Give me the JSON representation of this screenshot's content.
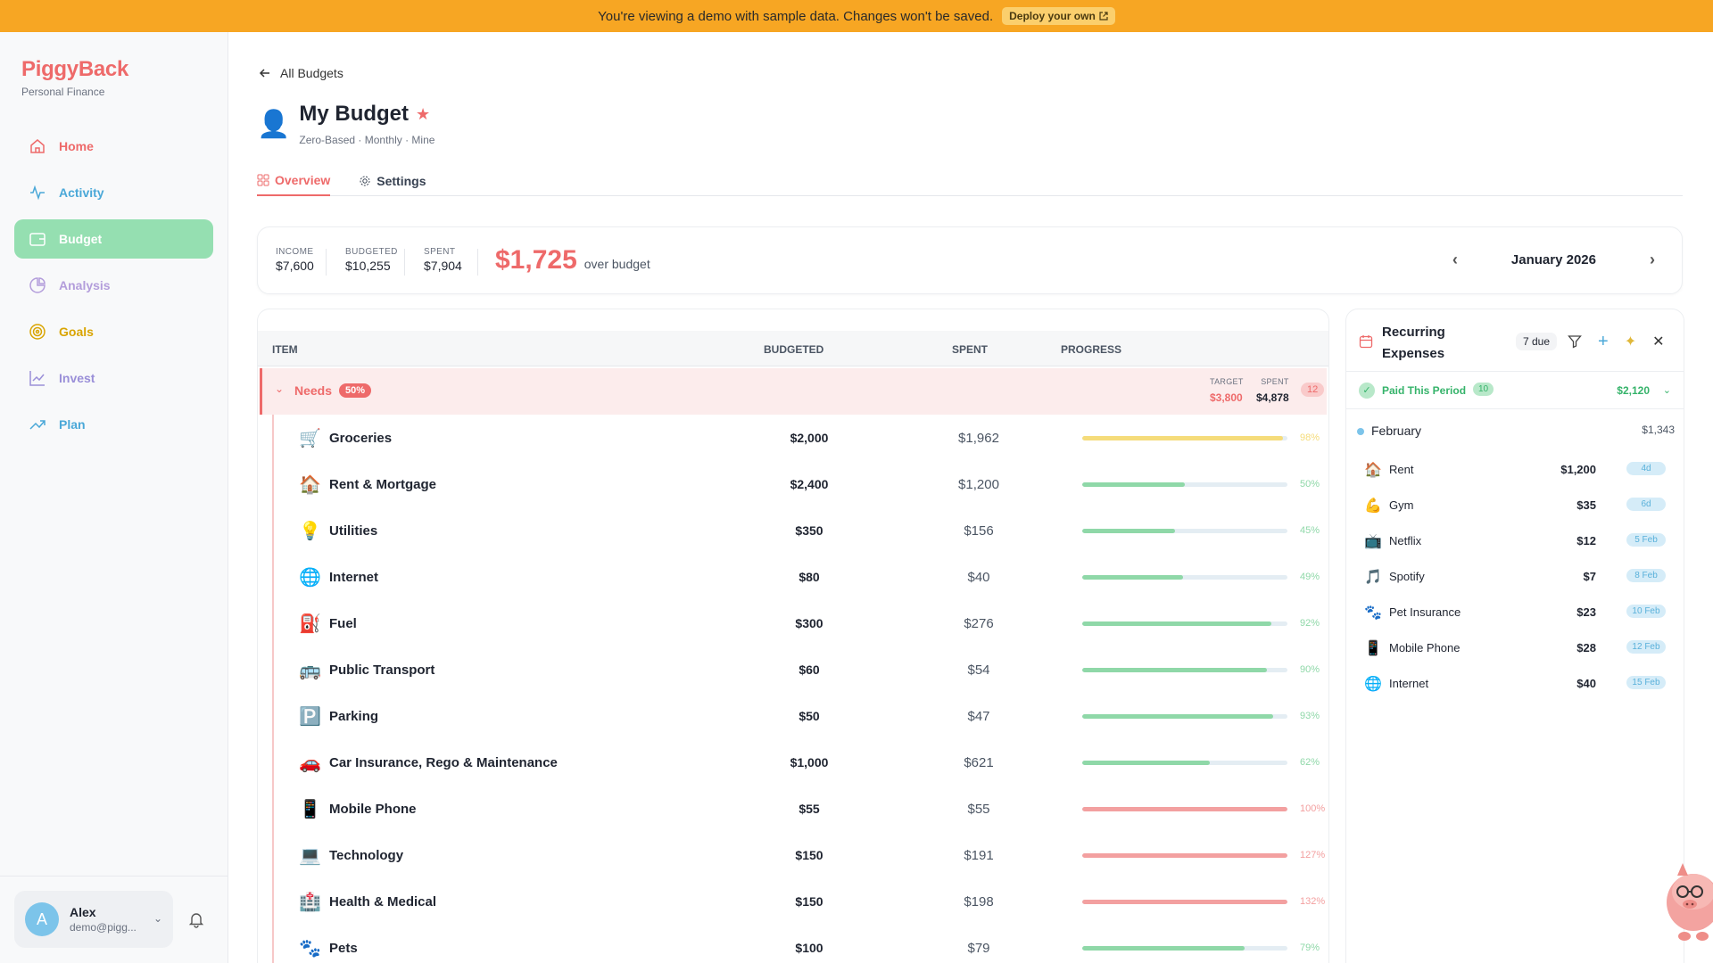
{
  "banner": {
    "text": "You're viewing a demo with sample data. Changes won't be saved.",
    "deploy_label": "Deploy your own"
  },
  "sidebar": {
    "brand": "PiggyBack",
    "brand_sub": "Personal Finance",
    "items": [
      {
        "label": "Home",
        "icon": "home-icon",
        "color": "#ee6a6a"
      },
      {
        "label": "Activity",
        "icon": "activity-icon",
        "color": "#4aa8d8"
      },
      {
        "label": "Budget",
        "icon": "wallet-icon",
        "color": "#ffffff",
        "active": true
      },
      {
        "label": "Analysis",
        "icon": "pie-chart-icon",
        "color": "#b39ddb"
      },
      {
        "label": "Goals",
        "icon": "target-icon",
        "color": "#d9a400"
      },
      {
        "label": "Invest",
        "icon": "line-chart-icon",
        "color": "#9a8fd8"
      },
      {
        "label": "Plan",
        "icon": "trending-up-icon",
        "color": "#4aa8d8"
      }
    ],
    "user": {
      "initial": "A",
      "name": "Alex",
      "email": "demo@pigg..."
    }
  },
  "header": {
    "back_label": "All Budgets",
    "title": "My Budget",
    "subtitle": "Zero-Based · Monthly · Mine",
    "tabs": [
      "Overview",
      "Settings"
    ]
  },
  "summary": {
    "income_label": "INCOME",
    "income": "$7,600",
    "budgeted_label": "BUDGETED",
    "budgeted": "$10,255",
    "spent_label": "SPENT",
    "spent": "$7,904",
    "over_amount": "$1,725",
    "over_text": "over budget",
    "month": "January 2026"
  },
  "table": {
    "headers": {
      "item": "ITEM",
      "budgeted": "BUDGETED",
      "spent": "SPENT",
      "progress": "PROGRESS"
    },
    "group": {
      "name": "Needs",
      "pct": "50%",
      "target_label": "TARGET",
      "target": "$3,800",
      "spent_label": "SPENT",
      "spent": "$4,878",
      "count": "12"
    },
    "rows": [
      {
        "emoji": "🛒",
        "name": "Groceries",
        "budgeted": "$2,000",
        "spent": "$1,962",
        "pct": "98%",
        "progress": 0.98,
        "color": "#f5dc7a",
        "pct_color": "#f5dc7a"
      },
      {
        "emoji": "🏠",
        "name": "Rent & Mortgage",
        "budgeted": "$2,400",
        "spent": "$1,200",
        "pct": "50%",
        "progress": 0.5,
        "color": "#8fd8a8",
        "pct_color": "#8fd8a8"
      },
      {
        "emoji": "💡",
        "name": "Utilities",
        "budgeted": "$350",
        "spent": "$156",
        "pct": "45%",
        "progress": 0.45,
        "color": "#8fd8a8",
        "pct_color": "#8fd8a8"
      },
      {
        "emoji": "🌐",
        "name": "Internet",
        "budgeted": "$80",
        "spent": "$40",
        "pct": "49%",
        "progress": 0.49,
        "color": "#8fd8a8",
        "pct_color": "#8fd8a8"
      },
      {
        "emoji": "⛽",
        "name": "Fuel",
        "budgeted": "$300",
        "spent": "$276",
        "pct": "92%",
        "progress": 0.92,
        "color": "#8fd8a8",
        "pct_color": "#8fd8a8"
      },
      {
        "emoji": "🚌",
        "name": "Public Transport",
        "budgeted": "$60",
        "spent": "$54",
        "pct": "90%",
        "progress": 0.9,
        "color": "#8fd8a8",
        "pct_color": "#8fd8a8"
      },
      {
        "emoji": "🅿️",
        "name": "Parking",
        "budgeted": "$50",
        "spent": "$47",
        "pct": "93%",
        "progress": 0.93,
        "color": "#8fd8a8",
        "pct_color": "#8fd8a8"
      },
      {
        "emoji": "🚗",
        "name": "Car Insurance, Rego & Maintenance",
        "budgeted": "$1,000",
        "spent": "$621",
        "pct": "62%",
        "progress": 0.62,
        "color": "#8fd8a8",
        "pct_color": "#8fd8a8"
      },
      {
        "emoji": "📱",
        "name": "Mobile Phone",
        "budgeted": "$55",
        "spent": "$55",
        "pct": "100%",
        "progress": 1.0,
        "color": "#f3a0a0",
        "pct_color": "#f3a0a0"
      },
      {
        "emoji": "💻",
        "name": "Technology",
        "budgeted": "$150",
        "spent": "$191",
        "pct": "127%",
        "progress": 1.0,
        "color": "#f3a0a0",
        "pct_color": "#f3a0a0"
      },
      {
        "emoji": "🏥",
        "name": "Health & Medical",
        "budgeted": "$150",
        "spent": "$198",
        "pct": "132%",
        "progress": 1.0,
        "color": "#f3a0a0",
        "pct_color": "#f3a0a0"
      },
      {
        "emoji": "🐾",
        "name": "Pets",
        "budgeted": "$100",
        "spent": "$79",
        "pct": "79%",
        "progress": 0.79,
        "color": "#8fd8a8",
        "pct_color": "#8fd8a8"
      }
    ]
  },
  "recurring": {
    "title": "Recurring Expenses",
    "due": "7 due",
    "paid_label": "Paid This Period",
    "paid_count": "10",
    "paid_amount": "$2,120",
    "month": "February",
    "month_total": "$1,343",
    "items": [
      {
        "emoji": "🏠",
        "name": "Rent",
        "amount": "$1,200",
        "due": "4d"
      },
      {
        "emoji": "💪",
        "name": "Gym",
        "amount": "$35",
        "due": "6d"
      },
      {
        "emoji": "📺",
        "name": "Netflix",
        "amount": "$12",
        "due": "5 Feb"
      },
      {
        "emoji": "🎵",
        "name": "Spotify",
        "amount": "$7",
        "due": "8 Feb"
      },
      {
        "emoji": "🐾",
        "name": "Pet Insurance",
        "amount": "$23",
        "due": "10 Feb"
      },
      {
        "emoji": "📱",
        "name": "Mobile Phone",
        "amount": "$28",
        "due": "12 Feb"
      },
      {
        "emoji": "🌐",
        "name": "Internet",
        "amount": "$40",
        "due": "15 Feb"
      }
    ]
  }
}
